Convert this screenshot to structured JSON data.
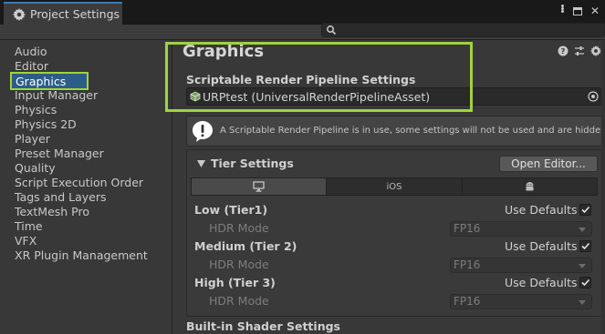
{
  "window": {
    "tab_title": "Project Settings"
  },
  "search": {
    "placeholder": ""
  },
  "sidebar": {
    "items": [
      {
        "label": "Audio"
      },
      {
        "label": "Editor"
      },
      {
        "label": "Graphics",
        "selected": true
      },
      {
        "label": "Input Manager"
      },
      {
        "label": "Physics"
      },
      {
        "label": "Physics 2D"
      },
      {
        "label": "Player"
      },
      {
        "label": "Preset Manager"
      },
      {
        "label": "Quality"
      },
      {
        "label": "Script Execution Order"
      },
      {
        "label": "Tags and Layers"
      },
      {
        "label": "TextMesh Pro"
      },
      {
        "label": "Time"
      },
      {
        "label": "VFX"
      },
      {
        "label": "XR Plugin Management"
      }
    ]
  },
  "main": {
    "title": "Graphics",
    "srp_label": "Scriptable Render Pipeline Settings",
    "srp_asset": "URPtest (UniversalRenderPipelineAsset)",
    "help_text": "A Scriptable Render Pipeline is in use, some settings will not be used and are hidden",
    "tier_settings": {
      "title": "Tier Settings",
      "open_editor_label": "Open Editor...",
      "platform_tabs": [
        {
          "icon": "monitor-icon",
          "label": "",
          "active": true
        },
        {
          "icon": "",
          "label": "iOS",
          "active": false
        },
        {
          "icon": "android-icon",
          "label": "",
          "active": false
        }
      ],
      "tiers": [
        {
          "name": "Low (Tier1)",
          "use_defaults_label": "Use Defaults",
          "use_defaults": true,
          "hdr_label": "HDR Mode",
          "hdr_value": "FP16"
        },
        {
          "name": "Medium (Tier 2)",
          "use_defaults_label": "Use Defaults",
          "use_defaults": true,
          "hdr_label": "HDR Mode",
          "hdr_value": "FP16"
        },
        {
          "name": "High (Tier 3)",
          "use_defaults_label": "Use Defaults",
          "use_defaults": true,
          "hdr_label": "HDR Mode",
          "hdr_value": "FP16"
        }
      ]
    },
    "builtin_shader_label": "Built-in Shader Settings"
  },
  "colors": {
    "highlight": "#9ed43b",
    "selection": "#2c5d87",
    "tab_accent": "#3a79bb"
  }
}
